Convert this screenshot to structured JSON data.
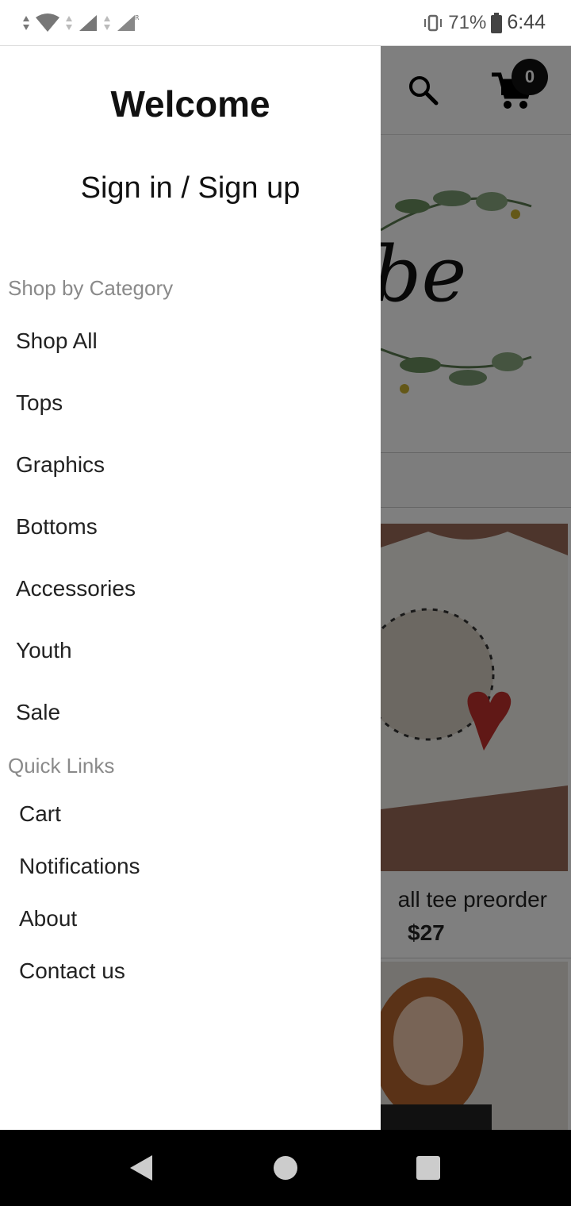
{
  "status_bar": {
    "battery": "71%",
    "time": "6:44"
  },
  "header": {
    "cart_count": "0"
  },
  "banner": {
    "visible_text": "be"
  },
  "product": {
    "title": "all tee preorder",
    "price": "$27"
  },
  "drawer": {
    "welcome": "Welcome",
    "sign_in": "Sign in / Sign up",
    "categories_label": "Shop by Category",
    "categories": [
      "Shop All",
      "Tops",
      "Graphics",
      "Bottoms",
      "Accessories",
      "Youth",
      "Sale"
    ],
    "quick_links_label": "Quick Links",
    "quick_links": [
      "Cart",
      "Notifications",
      "About",
      "Contact us"
    ]
  },
  "colors": {
    "scrim": "#000000",
    "drawer_bg": "#ffffff",
    "section_label": "#8a8a8a",
    "text": "#222222"
  }
}
